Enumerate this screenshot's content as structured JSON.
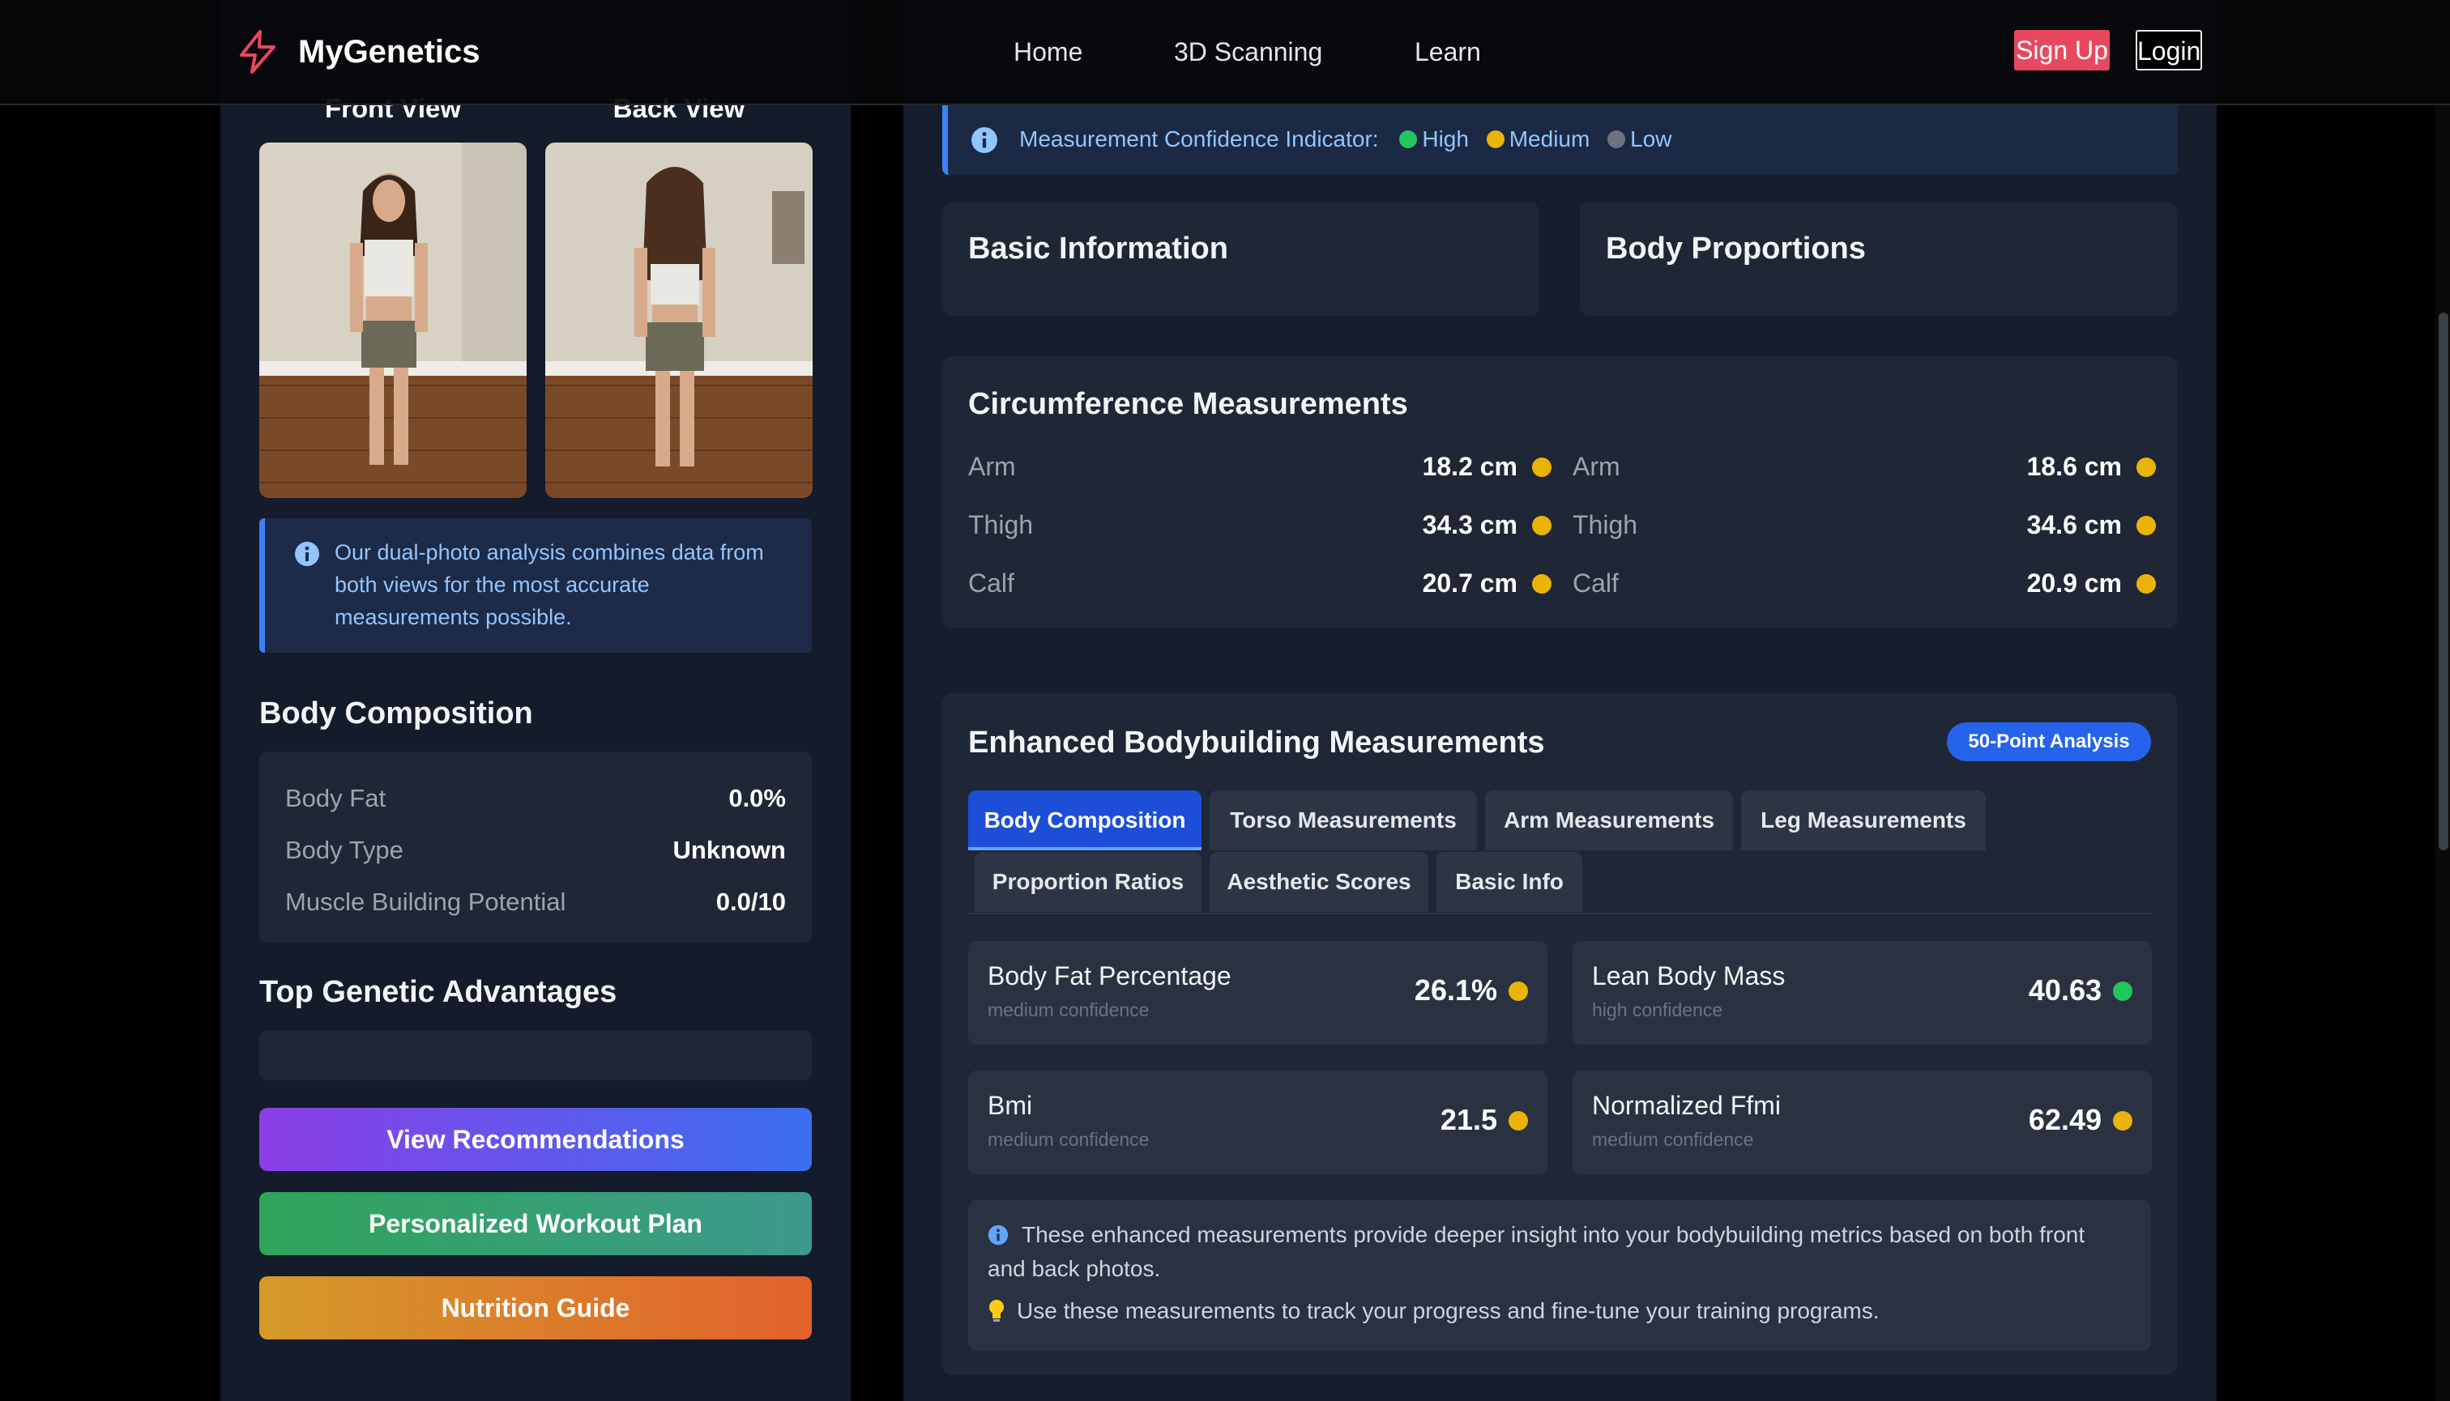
{
  "nav": {
    "brand": "MyGenetics",
    "links": [
      "Home",
      "3D Scanning",
      "Learn"
    ],
    "signup": "Sign Up",
    "login": "Login"
  },
  "left": {
    "front_view": "Front View",
    "back_view": "Back View",
    "info_note": "Our dual-photo analysis combines data from both views for the most accurate measurements possible.",
    "body_composition": {
      "title": "Body Composition",
      "rows": [
        {
          "label": "Body Fat",
          "value": "0.0%"
        },
        {
          "label": "Body Type",
          "value": "Unknown"
        },
        {
          "label": "Muscle Building Potential",
          "value": "0.0/10"
        }
      ]
    },
    "top_advantages_title": "Top Genetic Advantages",
    "buttons": {
      "recommendations": "View Recommendations",
      "workout": "Personalized Workout Plan",
      "nutrition": "Nutrition Guide"
    }
  },
  "right": {
    "confidence": {
      "label": "Measurement Confidence Indicator:",
      "high": "High",
      "medium": "Medium",
      "low": "Low"
    },
    "basic_info_title": "Basic Information",
    "body_proportions_title": "Body Proportions",
    "circumference": {
      "title": "Circumference Measurements",
      "left": [
        {
          "label": "Arm",
          "value": "18.2 cm"
        },
        {
          "label": "Thigh",
          "value": "34.3 cm"
        },
        {
          "label": "Calf",
          "value": "20.7 cm"
        }
      ],
      "right": [
        {
          "label": "Arm",
          "value": "18.6 cm"
        },
        {
          "label": "Thigh",
          "value": "34.6 cm"
        },
        {
          "label": "Calf",
          "value": "20.9 cm"
        }
      ]
    },
    "enhanced": {
      "title": "Enhanced Bodybuilding Measurements",
      "badge": "50-Point Analysis",
      "tabs": [
        "Body Composition",
        "Torso Measurements",
        "Arm Measurements",
        "Leg Measurements",
        "Proportion Ratios",
        "Aesthetic Scores",
        "Basic Info"
      ],
      "active_tab": "Body Composition",
      "metrics": [
        {
          "label": "Body Fat Percentage",
          "confidence": "medium confidence",
          "value": "26.1%"
        },
        {
          "label": "Lean Body Mass",
          "confidence": "high confidence",
          "value": "40.63"
        },
        {
          "label": "Bmi",
          "confidence": "medium confidence",
          "value": "21.5"
        },
        {
          "label": "Normalized Ffmi",
          "confidence": "medium confidence",
          "value": "62.49"
        }
      ],
      "note1": "These enhanced measurements provide deeper insight into your bodybuilding metrics based on both front and back photos.",
      "note2": "Use these measurements to track your progress and fine-tune your training programs."
    }
  },
  "colors": {
    "high": "#22c55e",
    "medium": "#eab308",
    "low": "#6b7280",
    "accent": "#3b82f6",
    "brand": "#e8485f"
  },
  "icons": {
    "logo": "lightning-icon",
    "info": "info-icon",
    "tip": "lightbulb-icon"
  }
}
